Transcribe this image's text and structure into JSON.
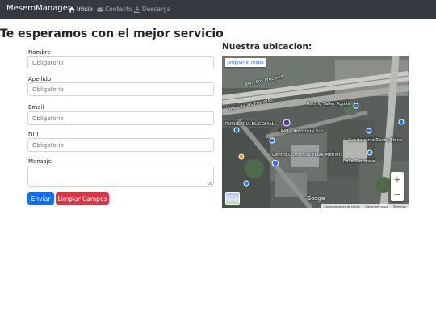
{
  "navbar": {
    "brand": "MeseroManager",
    "links": [
      {
        "label": "Inicio",
        "icon": "home-icon",
        "active": true
      },
      {
        "label": "Contacto",
        "icon": "envelope-icon",
        "active": false
      },
      {
        "label": "Descarga",
        "icon": "download-icon",
        "active": false
      }
    ]
  },
  "page": {
    "title": "Te esperamos con el mejor servicio"
  },
  "form": {
    "fields": [
      {
        "label": "Nombre",
        "placeholder": "Obligatorio"
      },
      {
        "label": "Apellido",
        "placeholder": "Obligatorio"
      },
      {
        "label": "Email",
        "placeholder": "Obligatorio"
      },
      {
        "label": "DUI",
        "placeholder": "Obligatorio"
      },
      {
        "label": "Mensaje",
        "placeholder": ""
      }
    ],
    "submit_label": "Enviar",
    "clear_label": "Limpiar Campos"
  },
  "map": {
    "title": "Nuestra ubicacion:",
    "expand_label": "Ampliar el mapa",
    "labels": [
      "Blvr. Los Proceres",
      "Blvr. de los Proceres",
      "Racing Taller Aguila",
      "UNO - Autopista Sur",
      "PUPUSERIA EL COMAL",
      "Centro Comercial Plaza Merliot",
      "Condominio Santa Elena",
      "Pollo Campero"
    ],
    "google_logo": "Google",
    "attribution": [
      "Combinaciones de teclas",
      "Datos del mapa",
      "Términos"
    ]
  },
  "colors": {
    "navbar_bg": "#343a40",
    "primary": "#0d6efd",
    "danger": "#dc3545"
  }
}
